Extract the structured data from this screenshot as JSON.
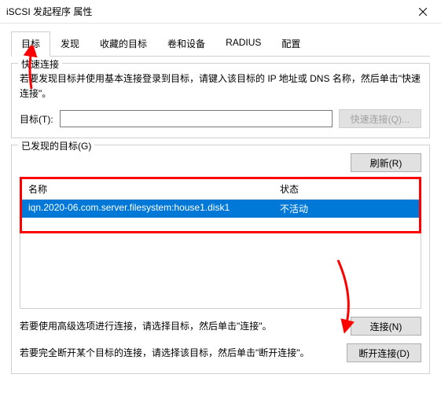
{
  "window": {
    "title": "iSCSI 发起程序 属性"
  },
  "tabs": [
    {
      "label": "目标"
    },
    {
      "label": "发现"
    },
    {
      "label": "收藏的目标"
    },
    {
      "label": "卷和设备"
    },
    {
      "label": "RADIUS"
    },
    {
      "label": "配置"
    }
  ],
  "quickConnect": {
    "title": "快速连接",
    "instruction": "若要发现目标并使用基本连接登录到目标，请键入该目标的 IP 地址或 DNS 名称，然后单击\"快速连接\"。",
    "targetLabel": "目标(T):",
    "targetValue": "",
    "buttonLabel": "快速连接(Q)..."
  },
  "discovered": {
    "title": "已发现的目标(G)",
    "refreshLabel": "刷新(R)",
    "columns": {
      "name": "名称",
      "status": "状态"
    },
    "rows": [
      {
        "name": "iqn.2020-06.com.server.filesystem:house1.disk1",
        "status": "不活动"
      }
    ],
    "connectText": "若要使用高级选项进行连接，请选择目标，然后单击\"连接\"。",
    "connectLabel": "连接(N)",
    "disconnectText": "若要完全断开某个目标的连接，请选择该目标，然后单击\"断开连接\"。",
    "disconnectLabel": "断开连接(D)"
  }
}
